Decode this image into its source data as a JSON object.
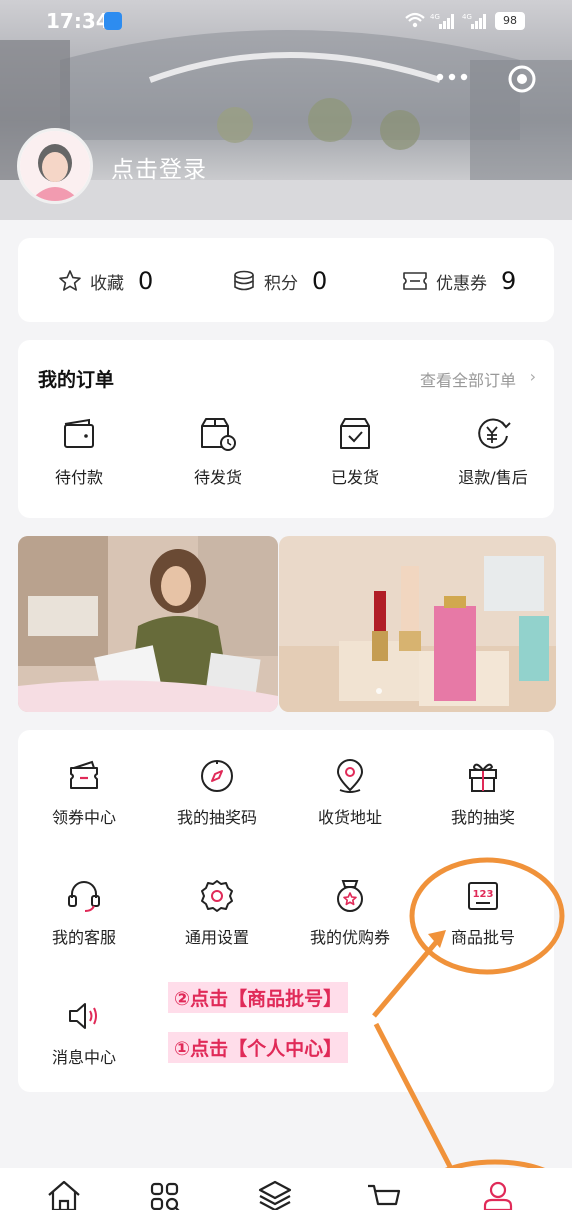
{
  "status_bar": {
    "time": "17:34",
    "battery": "98",
    "network_labels": [
      "4G",
      "4G"
    ]
  },
  "header": {
    "login_text": "点击登录",
    "icons": [
      "more-icon",
      "target-icon",
      "avatar"
    ]
  },
  "stats": [
    {
      "label": "收藏",
      "value": "0",
      "icon": "star-icon"
    },
    {
      "label": "积分",
      "value": "0",
      "icon": "coins-icon"
    },
    {
      "label": "优惠券",
      "value": "9",
      "icon": "coupon-icon"
    }
  ],
  "orders": {
    "title": "我的订单",
    "view_all": "查看全部订单",
    "items": [
      {
        "label": "待付款",
        "icon": "wallet-icon"
      },
      {
        "label": "待发货",
        "icon": "box-clock-icon"
      },
      {
        "label": "已发货",
        "icon": "box-check-icon"
      },
      {
        "label": "退款/售后",
        "icon": "refund-icon"
      }
    ]
  },
  "services": [
    {
      "label": "领券中心",
      "icon": "coupon-center-icon"
    },
    {
      "label": "我的抽奖码",
      "icon": "compass-icon"
    },
    {
      "label": "收货地址",
      "icon": "location-icon"
    },
    {
      "label": "我的抽奖",
      "icon": "gift-icon"
    },
    {
      "label": "我的客服",
      "icon": "headset-icon"
    },
    {
      "label": "通用设置",
      "icon": "settings-icon"
    },
    {
      "label": "我的优购券",
      "icon": "medal-icon"
    },
    {
      "label": "商品批号",
      "icon": "batch-number-icon",
      "icon_text": "123"
    },
    {
      "label": "消息中心",
      "icon": "speaker-icon"
    }
  ],
  "annotations": {
    "step2": "②点击【商品批号】",
    "step1": "①点击【个人中心】"
  },
  "bottom_nav": [
    {
      "icon": "home-icon"
    },
    {
      "icon": "category-icon"
    },
    {
      "icon": "layers-icon"
    },
    {
      "icon": "cart-icon"
    },
    {
      "icon": "user-icon",
      "active": true
    }
  ],
  "colors": {
    "accent": "#e02a58",
    "annotation_orange": "#f0923a",
    "card_bg": "#ffffff",
    "page_bg": "#f4f4f6"
  }
}
